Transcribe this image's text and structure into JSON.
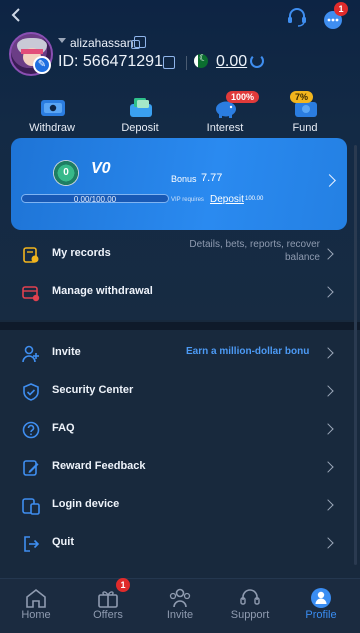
{
  "header": {
    "back_icon": "chevron-left-icon",
    "support_icon": "headset-icon",
    "messages_badge": "1"
  },
  "profile": {
    "username": "alizahassan",
    "id_label": "ID: 566471291",
    "balance": "0.00",
    "flag": "pakistan-flag"
  },
  "actions": [
    {
      "label": "Withdraw",
      "icon": "withdraw-icon"
    },
    {
      "label": "Deposit",
      "icon": "deposit-icon"
    },
    {
      "label": "Interest",
      "icon": "piggy-bank-icon",
      "pill": "100%"
    },
    {
      "label": "Fund",
      "icon": "fund-icon",
      "pill": "7%"
    }
  ],
  "vip": {
    "badge": "0",
    "level": "V0",
    "progress_text": "0.00/100.00",
    "progress_fraction": 0,
    "bonus_label": "Bonus",
    "bonus_value": "7.77",
    "requires_label": "VIP requires",
    "deposit_link": "Deposit",
    "deposit_amount": "100.00"
  },
  "records": [
    {
      "label": "My records",
      "sub": "Details, bets, reports, recover balance"
    },
    {
      "label": "Manage withdrawal"
    }
  ],
  "menu": [
    {
      "label": "Invite",
      "promo": "Earn a million-dollar bonu"
    },
    {
      "label": "Security Center"
    },
    {
      "label": "FAQ"
    },
    {
      "label": "Reward Feedback"
    },
    {
      "label": "Login device"
    },
    {
      "label": "Quit"
    }
  ],
  "tabs": [
    {
      "label": "Home"
    },
    {
      "label": "Offers",
      "badge": "1"
    },
    {
      "label": "Invite"
    },
    {
      "label": "Support"
    },
    {
      "label": "Profile"
    }
  ],
  "colors": {
    "accent": "#2a8af0",
    "badge": "#e02b2b",
    "pill_red": "#e03a3a",
    "pill_gold": "#f2b51d"
  }
}
